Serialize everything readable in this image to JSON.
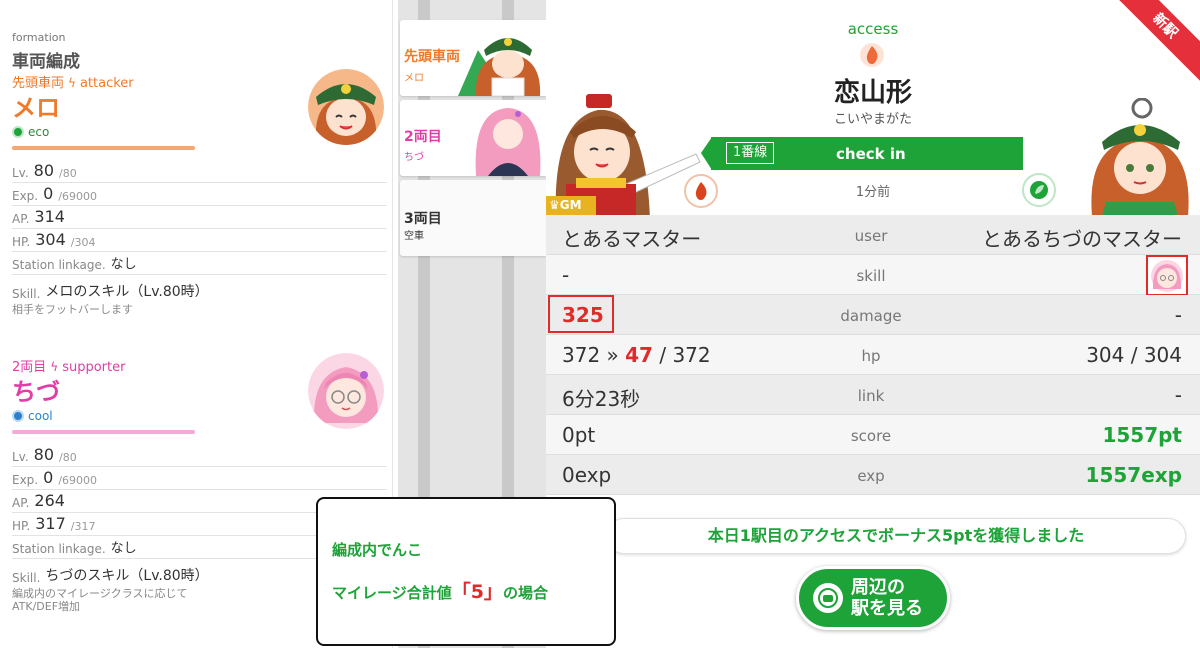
{
  "formation": {
    "label": "formation",
    "title": "車両編成",
    "cars": [
      {
        "position": "先頭車両",
        "role": "attacker",
        "name": "メロ",
        "attribute": "eco",
        "lv": "80",
        "lv_max": "/80",
        "exp": "0",
        "exp_max": "/69000",
        "ap": "314",
        "hp": "304",
        "hp_max": "/304",
        "station_linkage": "なし",
        "skill": "メロのスキル（Lv.80時）",
        "skill_desc": "相手をフットバーします",
        "color": "#f07a2a",
        "attr_color": "#1ea338"
      },
      {
        "position": "2両目",
        "role": "supporter",
        "name": "ちづ",
        "attribute": "cool",
        "lv": "80",
        "lv_max": "/80",
        "exp": "0",
        "exp_max": "/69000",
        "ap": "264",
        "hp": "317",
        "hp_max": "/317",
        "station_linkage": "なし",
        "skill": "ちづのスキル（Lv.80時）",
        "skill_desc": "編成内のマイレージクラスに応じてATK/DEF増加",
        "color": "#e23da6",
        "attr_color": "#2f7fd0"
      }
    ],
    "labels": {
      "lv": "Lv.",
      "exp": "Exp.",
      "ap": "AP.",
      "hp": "HP.",
      "station_linkage": "Station linkage.",
      "skill": "Skill."
    }
  },
  "train": {
    "cards": [
      {
        "label": "先頭車両",
        "sub": "メロ"
      },
      {
        "label": "2両目",
        "sub": "ちづ"
      },
      {
        "label": "3両目",
        "sub": "空車"
      }
    ]
  },
  "result": {
    "access_label": "access",
    "station_name": "恋山形",
    "station_kana": "こいやまがた",
    "line_badge": "1番線",
    "checkin_label": "check in",
    "time_ago": "1分前",
    "gm_badge": "GM",
    "new_station_tag": "新駅",
    "rows": [
      {
        "key": "user",
        "left": "とあるマスター",
        "right": "とあるちづのマスター"
      },
      {
        "key": "skill",
        "left": "-",
        "right": ""
      },
      {
        "key": "damage",
        "left": "325",
        "right": "-"
      },
      {
        "key": "hp",
        "left_a": "372 »",
        "left_b": "47",
        "left_c": "/ 372",
        "right": "304 / 304"
      },
      {
        "key": "link",
        "left": "6分23秒",
        "right": "-"
      },
      {
        "key": "score",
        "left": "0pt",
        "right": "1557pt"
      },
      {
        "key": "exp",
        "left": "0exp",
        "right": "1557exp"
      }
    ],
    "bonus_message": "本日1駅目のアクセスでボーナス5ptを獲得しました",
    "nearby_button": [
      "周辺の",
      "駅を見る"
    ]
  },
  "note": {
    "line1": "編成内でんこ",
    "line2_a": "マイレージ合計値",
    "line2_b": "「5」",
    "line2_c": "の場合"
  }
}
